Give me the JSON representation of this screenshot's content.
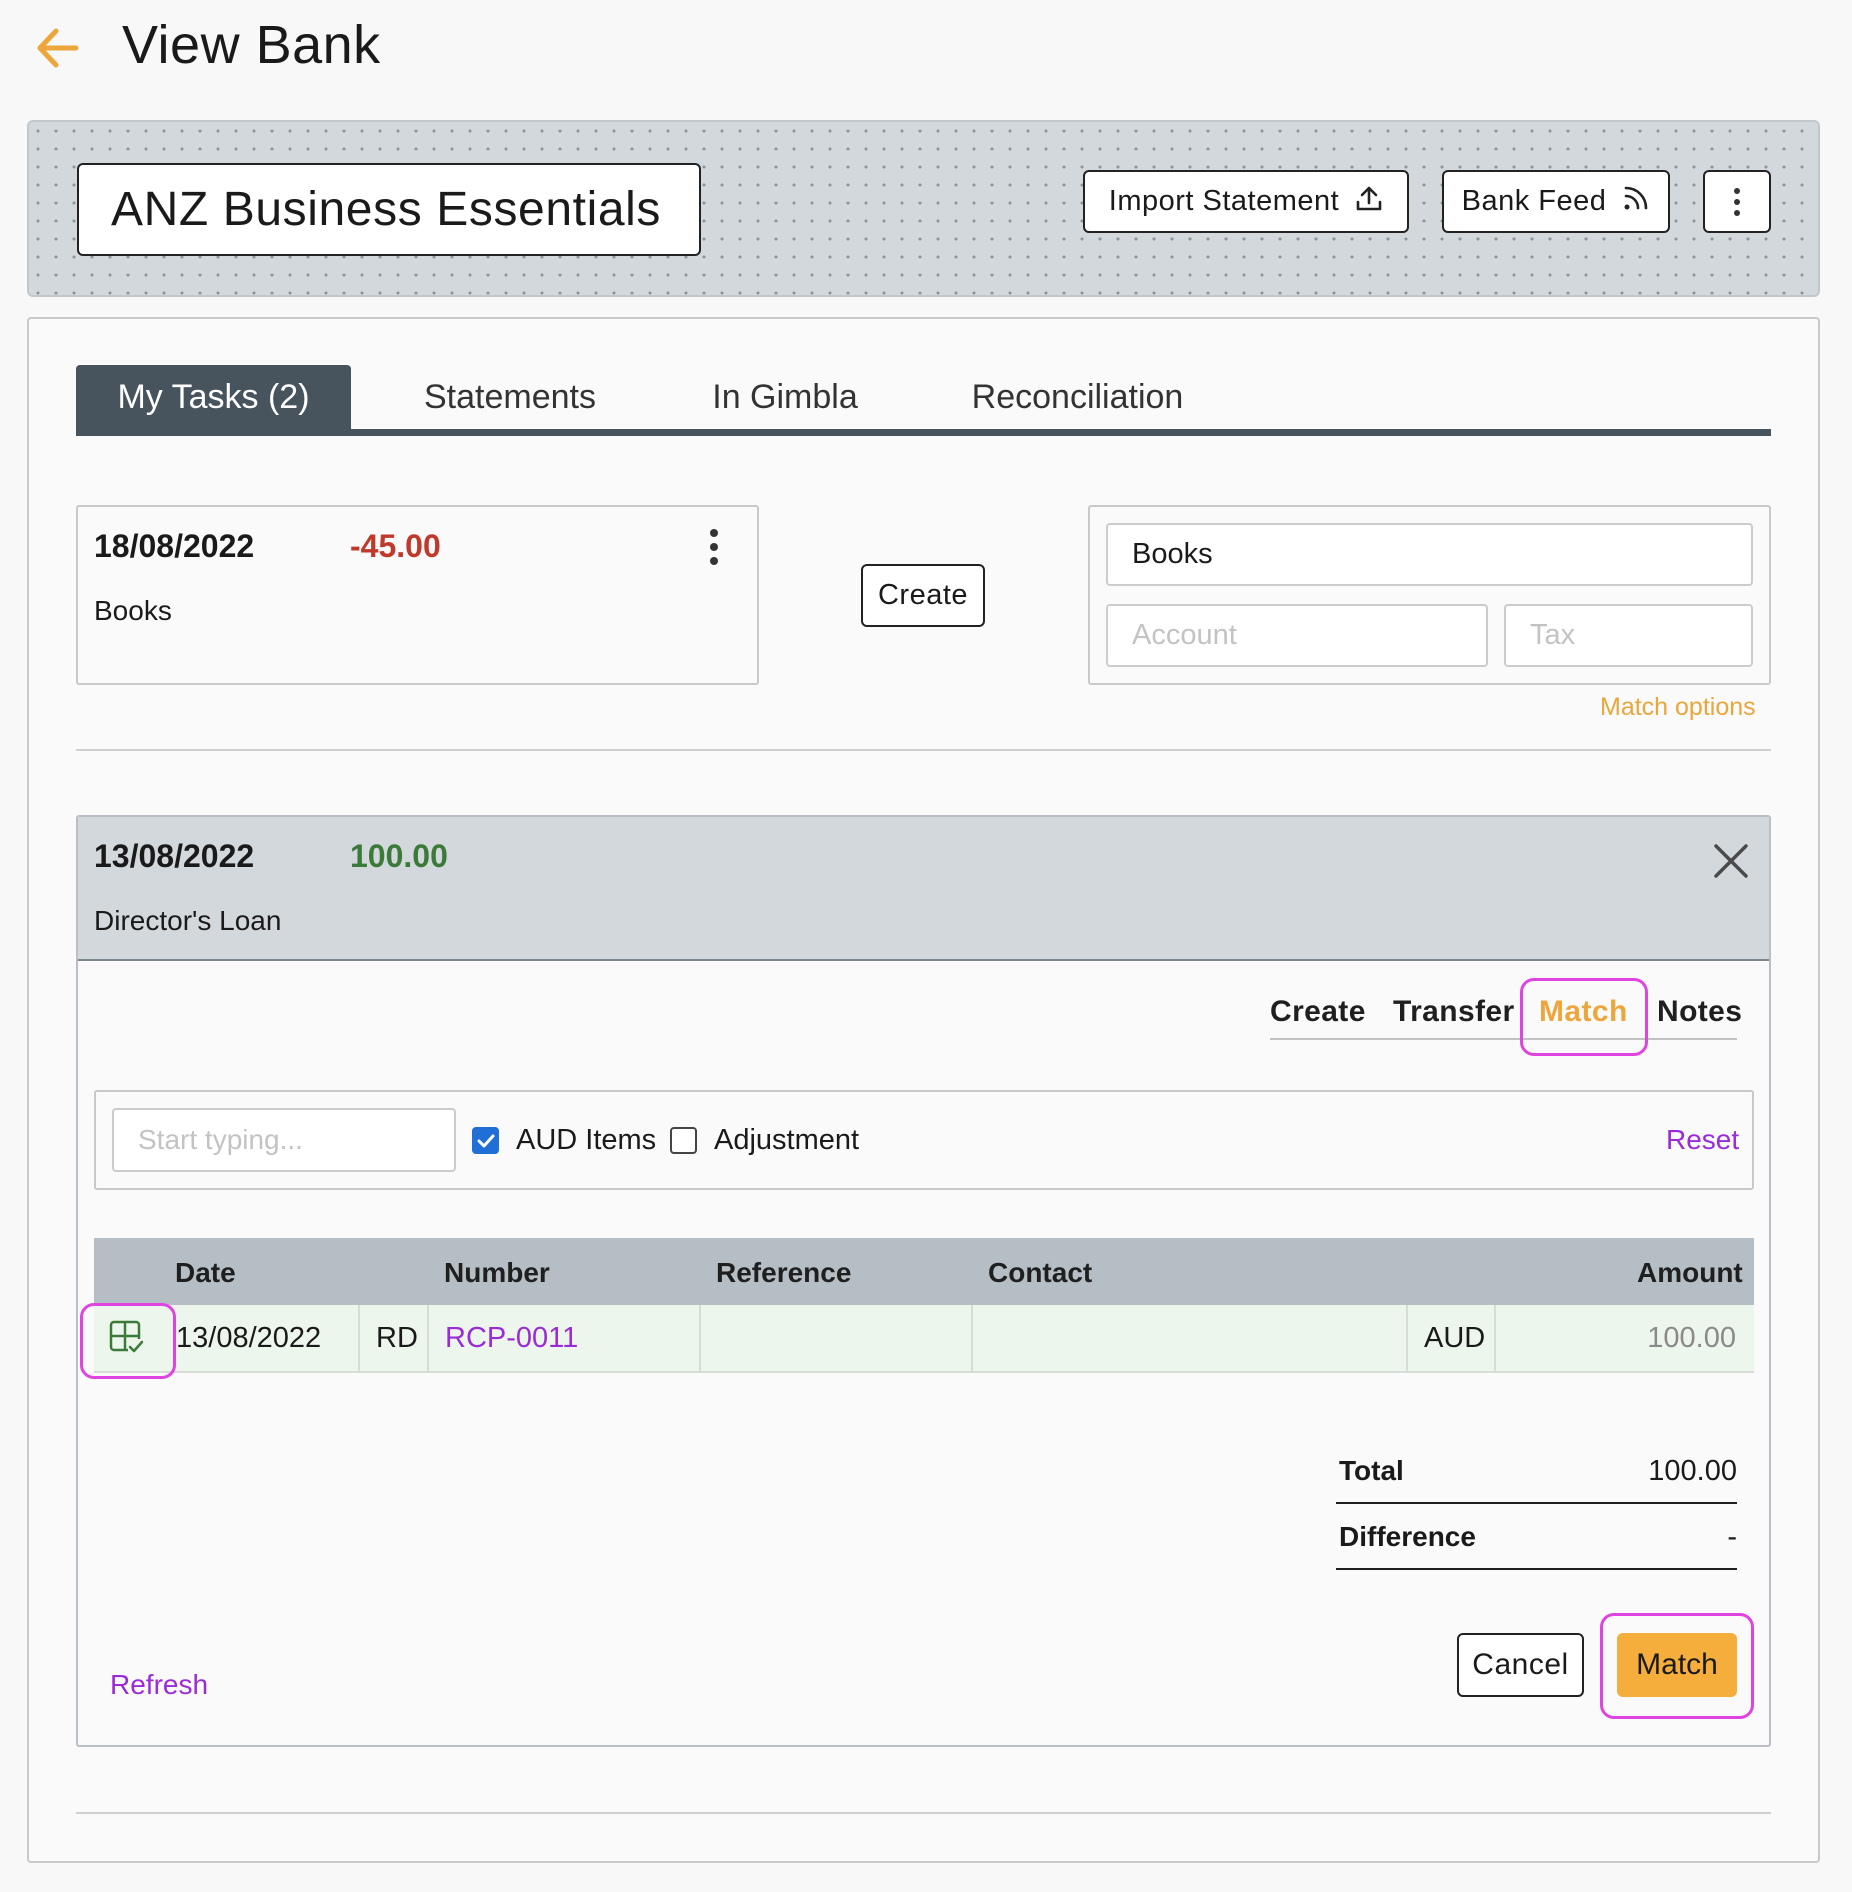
{
  "header": {
    "title": "View Bank"
  },
  "bank": {
    "name": "ANZ Business Essentials",
    "import_label": "Import Statement",
    "feed_label": "Bank Feed"
  },
  "tabs": [
    {
      "label": "My Tasks (2)"
    },
    {
      "label": "Statements"
    },
    {
      "label": "In Gimbla"
    },
    {
      "label": "Reconciliation"
    }
  ],
  "task1": {
    "date": "18/08/2022",
    "amount": "-45.00",
    "description": "Books",
    "create_label": "Create",
    "form": {
      "description_value": "Books",
      "account_placeholder": "Account",
      "tax_placeholder": "Tax"
    },
    "match_options_label": "Match options"
  },
  "task2": {
    "date": "13/08/2022",
    "amount": "100.00",
    "description": "Director's Loan",
    "subtabs": [
      "Create",
      "Transfer",
      "Match",
      "Notes"
    ],
    "filter": {
      "search_placeholder": "Start typing...",
      "aud_label": "AUD Items",
      "aud_checked": true,
      "adjustment_label": "Adjustment",
      "adjustment_checked": false,
      "reset_label": "Reset"
    },
    "table": {
      "headers": [
        "Date",
        "Number",
        "Reference",
        "Contact",
        "Amount"
      ],
      "rows": [
        {
          "date": "13/08/2022",
          "type": "RD",
          "number": "RCP-0011",
          "reference": "",
          "contact": "",
          "currency": "AUD",
          "amount": "100.00"
        }
      ]
    },
    "totals": {
      "total_label": "Total",
      "total_value": "100.00",
      "difference_label": "Difference",
      "difference_value": "-"
    },
    "refresh_label": "Refresh",
    "cancel_label": "Cancel",
    "match_label": "Match"
  },
  "colors": {
    "accent": "#f5ad3c",
    "negative": "#c0392b",
    "positive": "#3c7a3a",
    "link": "#9b2bd6",
    "highlight": "#e044e0",
    "tab_dark": "#47535d"
  }
}
